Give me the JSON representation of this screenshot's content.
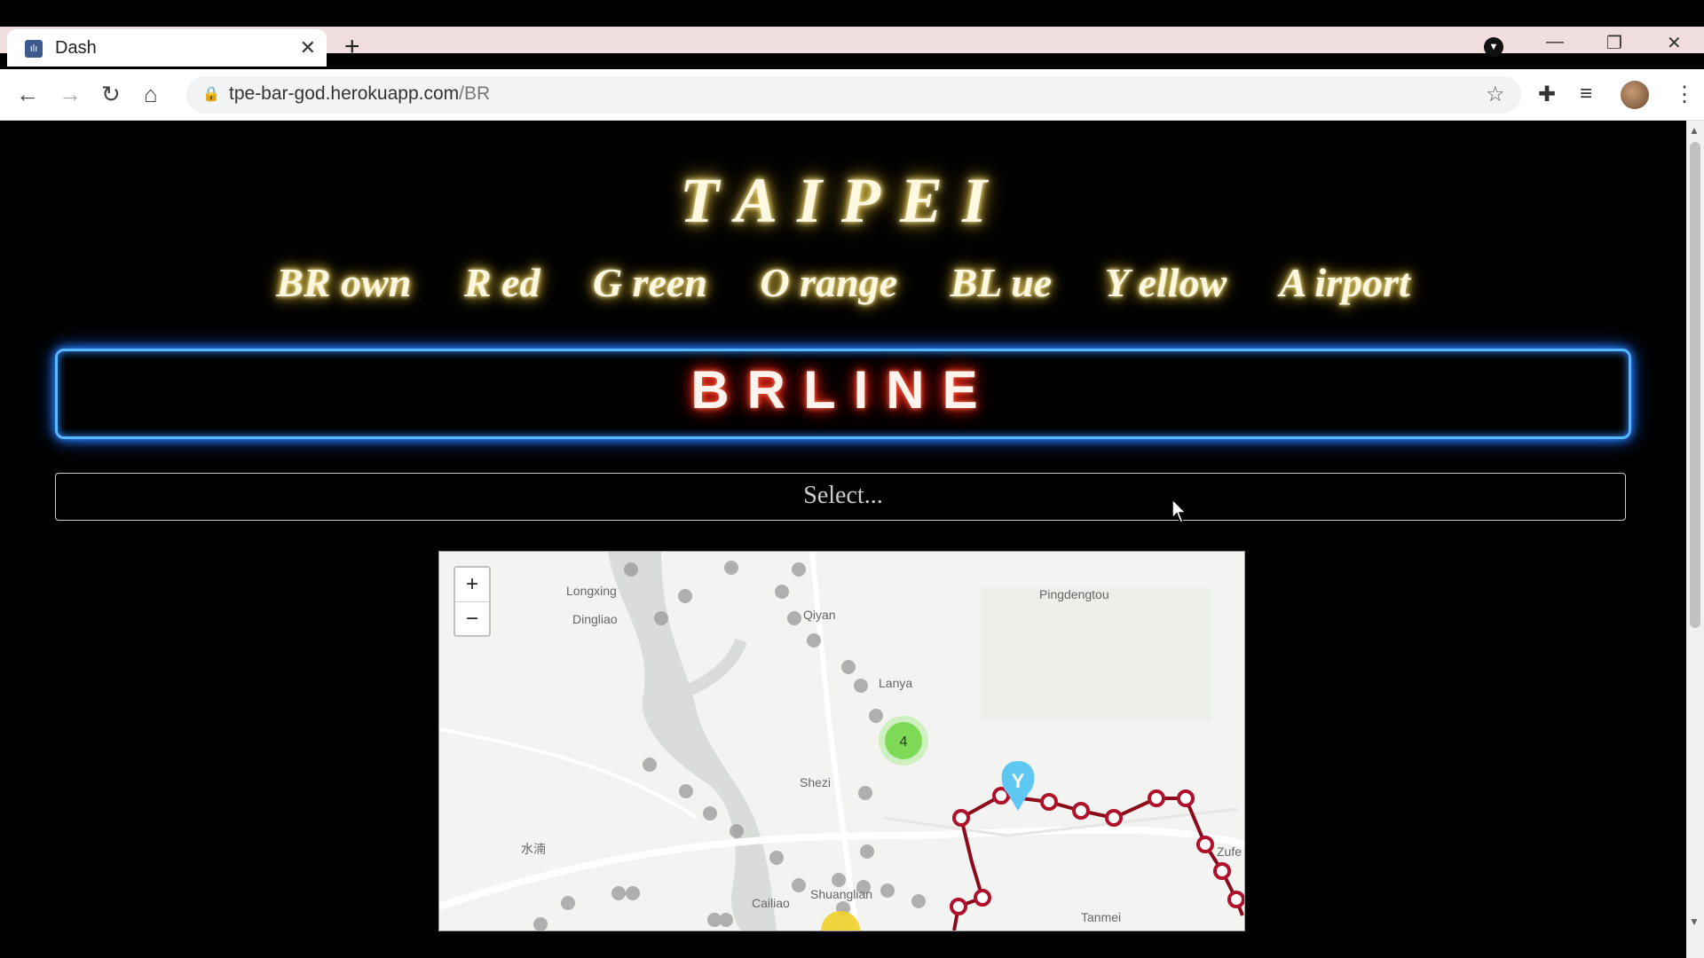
{
  "browser": {
    "tab_title": "Dash",
    "url_domain": "tpe-bar-god.herokuapp.com",
    "url_path": "/BR"
  },
  "page": {
    "title": "TAIPEI",
    "lines": [
      "BR own",
      "R ed",
      "G reen",
      "O range",
      "BL ue",
      "Y ellow",
      "A irport"
    ],
    "neon_title": "BRLINE",
    "select_placeholder": "Select..."
  },
  "map": {
    "zoom_in": "+",
    "zoom_out": "−",
    "cluster_count": "4",
    "labels": [
      "Longxing",
      "Dingliao",
      "Qiyan",
      "Pingdengtou",
      "Lanya",
      "Shezi",
      "水湳",
      "Shuanglian",
      "Cailiao",
      "Tanmei",
      "Zufe"
    ]
  },
  "colors": {
    "route": "#8b0b1a",
    "cluster": "#7ed957",
    "marker": "#5ec8f2",
    "neon_border": "#57b8ff",
    "neon_text_glow": "#ff2a1a",
    "title_glow": "#e8c84a"
  }
}
